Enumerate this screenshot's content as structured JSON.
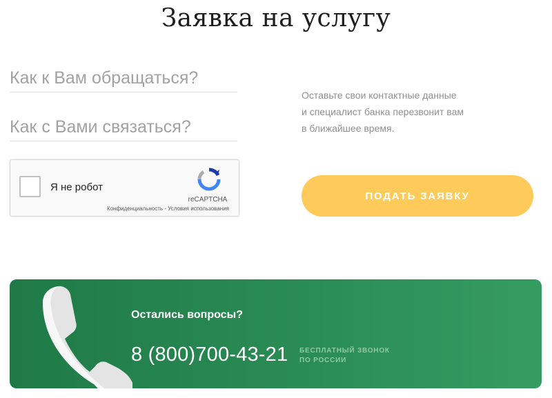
{
  "page": {
    "title": "Заявка на услугу"
  },
  "form": {
    "name_placeholder": "Как к Вам обращаться?",
    "contact_placeholder": "Как с Вами связаться?",
    "submit_label": "ПОДАТЬ ЗАЯВКУ",
    "hint_lines": [
      "Оставьте свои контактные данные",
      "и специалист банка перезвонит вам",
      "в ближайшее время."
    ]
  },
  "captcha": {
    "label": "Я не робот",
    "brand": "reCAPTCHA",
    "privacy_link": "Конфиденциальность",
    "separator": " - ",
    "terms_link": "Условия использования",
    "checked": false,
    "logo_icon": "recaptcha-logo-icon"
  },
  "contact_banner": {
    "question": "Остались вопросы?",
    "phone": "8 (800)700-43-21",
    "note_lines": [
      "БЕСПЛАТНЫЙ ЗВОНОК",
      "ПО РОССИИ"
    ],
    "icon": "phone-handset-icon"
  },
  "colors": {
    "submit_button": "#fecb5a",
    "banner_green": "#2a8c55",
    "hint_text": "#8f8f8f"
  }
}
